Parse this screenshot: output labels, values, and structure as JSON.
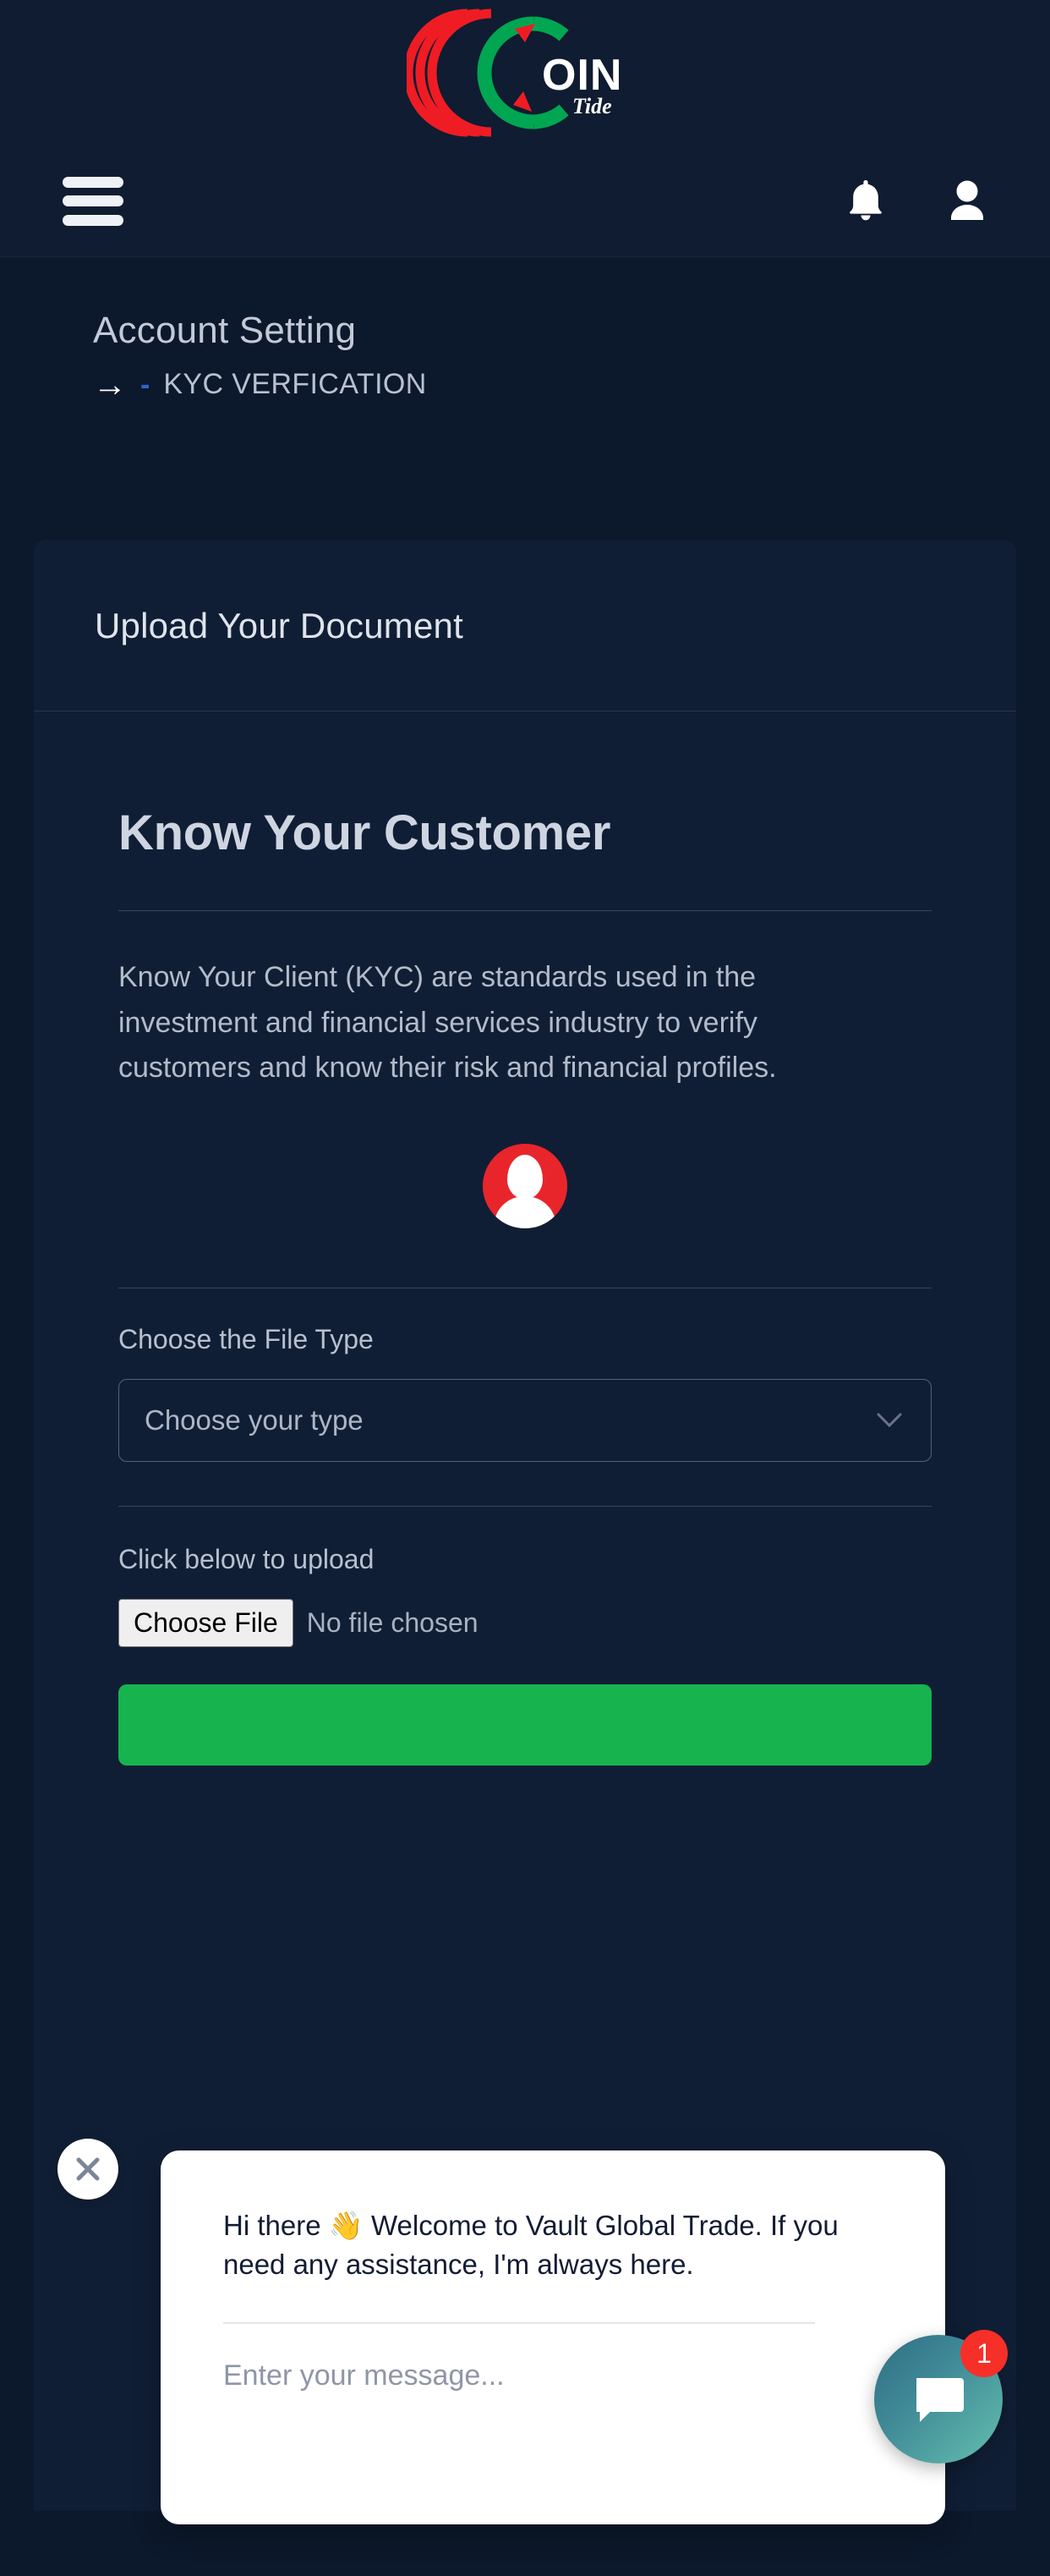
{
  "brand": {
    "name_main": "OIN",
    "name_sub": "Tide",
    "color_red": "#ef1c24",
    "color_green": "#00a651"
  },
  "nav": {
    "menu_icon": "hamburger-menu-icon",
    "notification_icon": "bell-icon",
    "profile_icon": "user-icon"
  },
  "breadcrumb": {
    "title": "Account Setting",
    "arrow": "→",
    "separator": "-",
    "current_page": "KYC VERFICATION"
  },
  "card": {
    "header_title": "Upload Your Document",
    "kyc_heading": "Know Your Customer",
    "kyc_description": "Know Your Client (KYC) are standards used in the investment and financial services industry to verify customers and know their risk and financial profiles.",
    "avatar_icon": "user-avatar-icon",
    "avatar_bg": "#e9252c",
    "file_type_label": "Choose the File Type",
    "file_type_value": "Choose your type",
    "file_type_chevron": "⌄",
    "upload_label": "Click below to upload",
    "choose_file_button": "Choose File",
    "no_file_text": "No file chosen",
    "submit_color": "#17b34f"
  },
  "chat": {
    "close_icon": "close-icon",
    "greeting": "Hi there 👋 Welcome to Vault Global Trade. If you need any assistance, I'm always here.",
    "input_placeholder": "Enter your message...",
    "input_value": "",
    "fab_icon": "chat-bubble-icon",
    "badge_count": "1",
    "badge_color": "#f62f28"
  }
}
